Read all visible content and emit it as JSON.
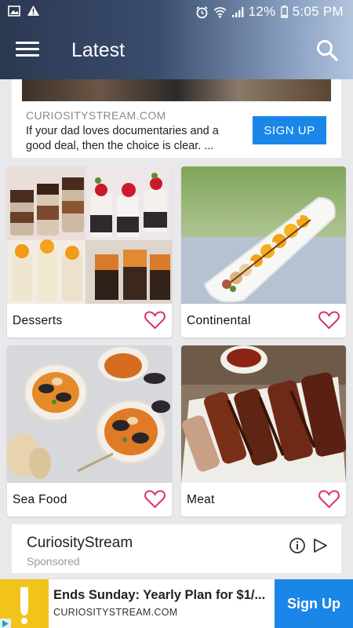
{
  "status_bar": {
    "battery": "12%",
    "time": "5:05 PM"
  },
  "app_bar": {
    "title": "Latest",
    "menu_icon": "hamburger-menu-icon",
    "search_icon": "search-icon"
  },
  "ad_top": {
    "domain": "CURIOSITYSTREAM.COM",
    "description": "If your dad loves documentaries and a good deal, then the choice is clear. ...",
    "cta_label": "SIGN UP"
  },
  "categories": [
    {
      "label": "Desserts"
    },
    {
      "label": "Continental"
    },
    {
      "label": "Sea Food"
    },
    {
      "label": "Meat"
    }
  ],
  "sponsored": {
    "name": "CuriosityStream",
    "tag": "Sponsored"
  },
  "banner_ad": {
    "title": "Ends Sunday: Yearly Plan for $1/...",
    "domain": "CURIOSITYSTREAM.COM",
    "cta_label": "Sign Up"
  },
  "colors": {
    "accent_blue": "#1a86e8",
    "heart_pink": "#d6336c",
    "header_dark": "#2b3852"
  }
}
